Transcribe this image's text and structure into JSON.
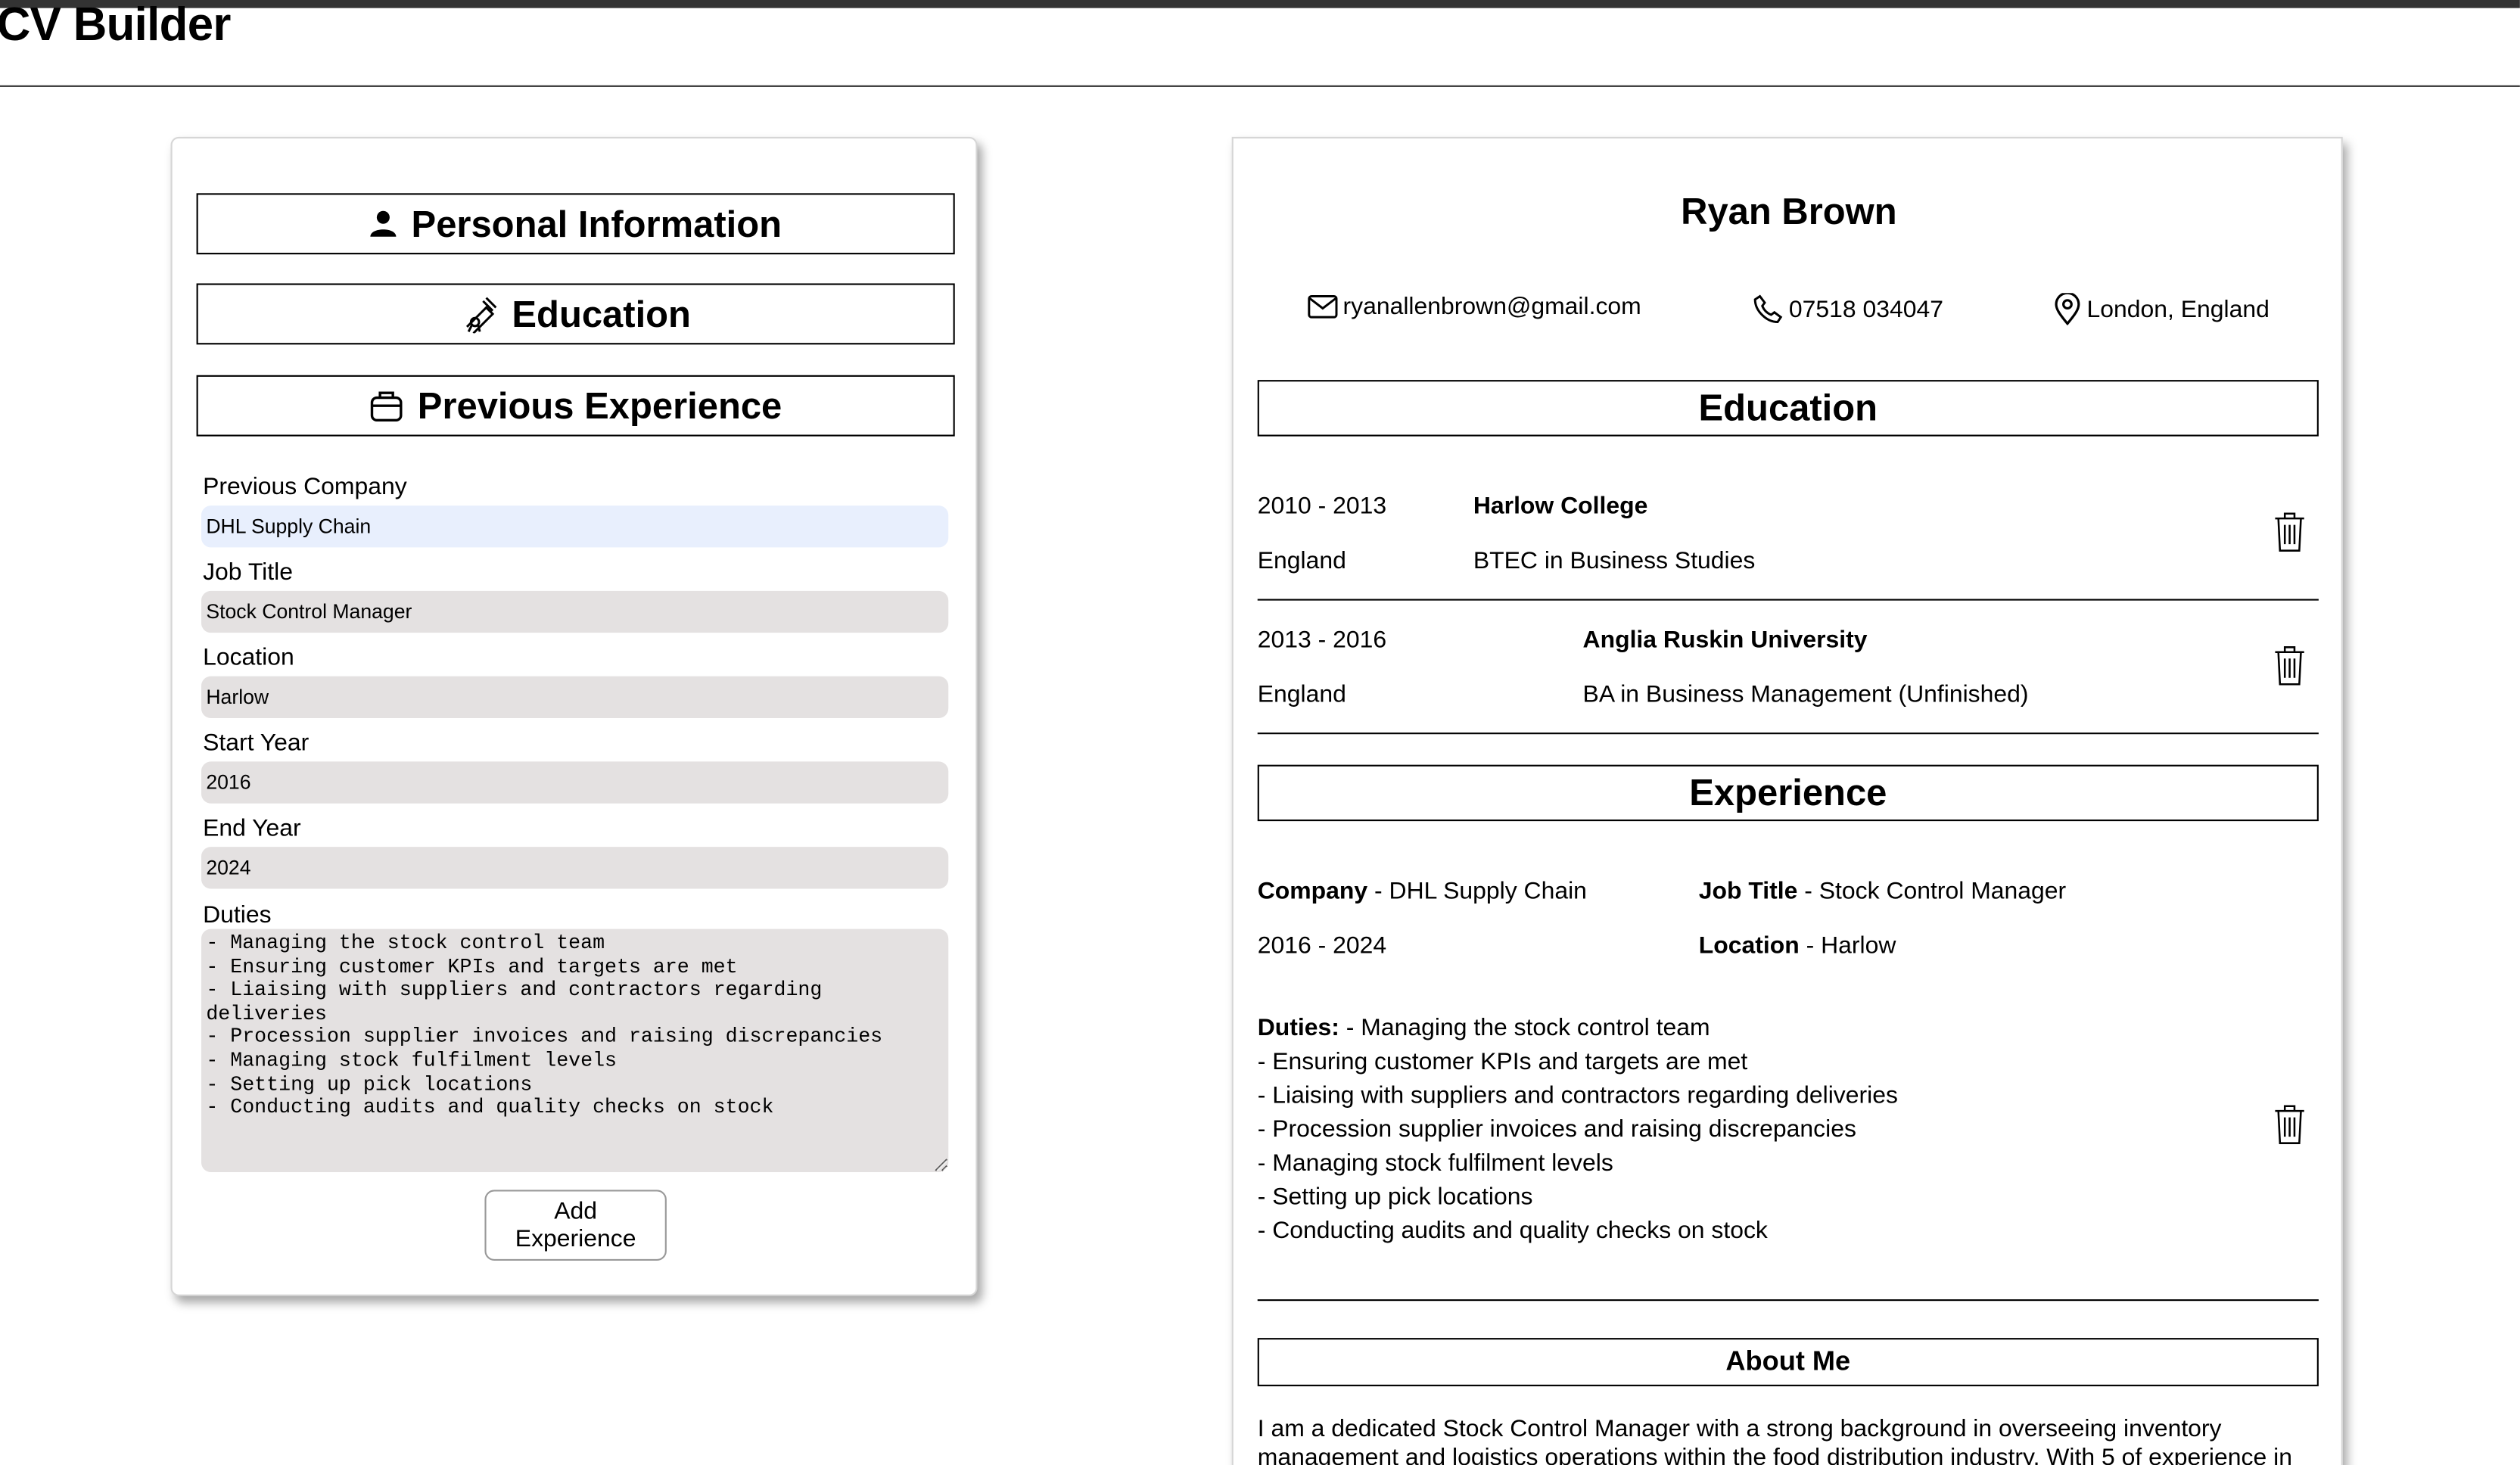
{
  "app": {
    "title": "CV Builder"
  },
  "form": {
    "sections": {
      "personal": "Personal Information",
      "education": "Education",
      "experience": "Previous Experience"
    },
    "fields": {
      "company_label": "Previous Company",
      "company_value": "DHL Supply Chain",
      "job_title_label": "Job Title",
      "job_title_value": "Stock Control Manager",
      "location_label": "Location",
      "location_value": "Harlow",
      "start_year_label": "Start Year",
      "start_year_value": "2016",
      "end_year_label": "End Year",
      "end_year_value": "2024",
      "duties_label": "Duties",
      "duties_value": "- Managing the stock control team\n- Ensuring customer KPIs and targets are met\n- Liaising with suppliers and contractors regarding deliveries\n- Procession supplier invoices and raising discrepancies\n- Managing stock fulfilment levels\n- Setting up pick locations\n- Conducting audits and quality checks on stock"
    },
    "add_button_label": "Add Experience"
  },
  "cv": {
    "name": "Ryan Brown",
    "email": "ryanallenbrown@gmail.com",
    "phone": "07518 034047",
    "location": "London, England",
    "education_heading": "Education",
    "education": [
      {
        "years": "2010 - 2013",
        "school": "Harlow College",
        "country": "England",
        "qualification": "BTEC in Business Studies"
      },
      {
        "years": "2013 - 2016",
        "school": "Anglia Ruskin University",
        "country": "England",
        "qualification": "BA in Business Management (Unfinished)"
      }
    ],
    "experience_heading": "Experience",
    "experience": {
      "company_label": "Company",
      "company": "DHL Supply Chain",
      "job_title_label": "Job Title",
      "job_title": "Stock Control Manager",
      "years": "2016 - 2024",
      "location_label": "Location",
      "location": "Harlow",
      "duties_label": "Duties:",
      "duties": [
        "- Managing the stock control team",
        "- Ensuring customer KPIs and targets are met",
        "- Liaising with suppliers and contractors regarding deliveries",
        "- Procession supplier invoices and raising discrepancies",
        "- Managing stock fulfilment levels",
        "- Setting up pick locations",
        "- Conducting audits and quality checks on stock"
      ]
    },
    "about_heading": "About Me",
    "about_text": "I am a dedicated Stock Control Manager with a strong background in overseeing inventory management and logistics operations within the food distribution industry. With 5 of experience in"
  },
  "icons": {
    "personal": "person-icon",
    "education": "diploma-icon",
    "experience": "briefcase-icon",
    "email": "mail-icon",
    "phone": "phone-icon",
    "location": "map-pin-icon",
    "delete": "trash-icon"
  }
}
